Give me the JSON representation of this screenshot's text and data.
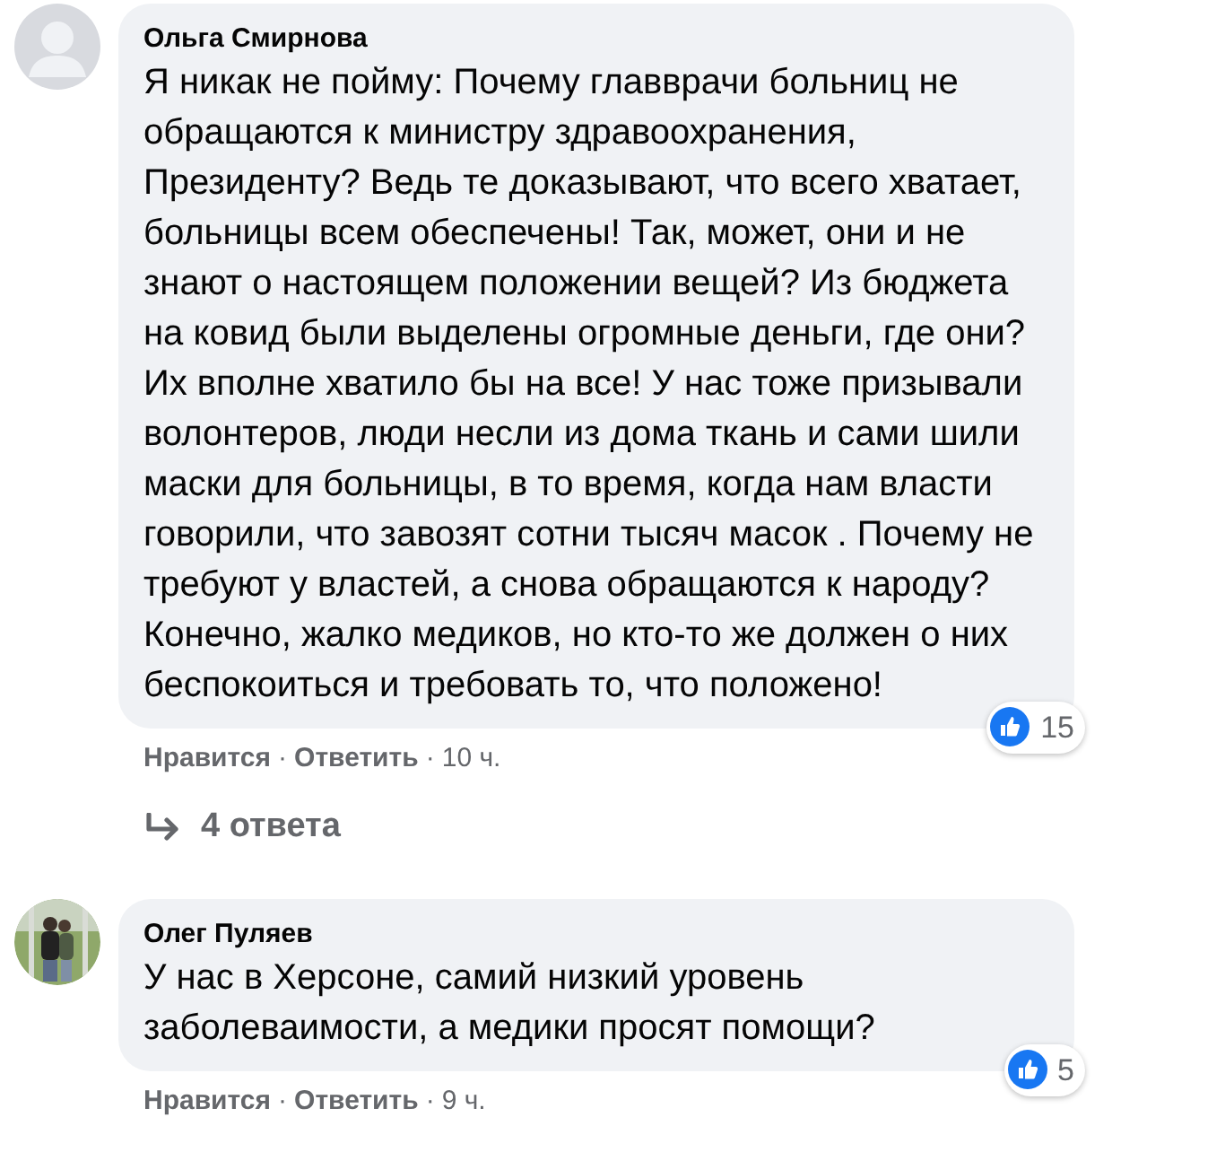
{
  "comments": [
    {
      "author": "Ольга Смирнова",
      "kind": "silhouette",
      "separator": "·",
      "text": "Я никак не пойму: Почему главврачи больниц не обращаются к министру здравоохранения, Президенту? Ведь те доказывают, что всего хватает, больницы всем обеспечены! Так, может, они и не знают о настоящем положении вещей? Из бюджета на ковид были выделены огромные деньги, где они? Их вполне хватило бы на все! У нас тоже призывали волонтеров, люди несли из дома ткань и сами шили маски для больницы, в то время, когда нам власти говорили, что завозят сотни тысяч масок . Почему не требуют у властей, а снова обращаются к народу? Конечно, жалко медиков, но кто-то же должен о них беспокоиться и требовать то, что положено!",
      "likes": "15",
      "like_action": "Нравится",
      "reply_action": "Ответить",
      "time": "10 ч.",
      "replies": "4 ответа"
    },
    {
      "author": "Олег Пуляев",
      "kind": "picture",
      "separator": "·",
      "text": "У нас в Херсоне, самий низкий уровень заболеваимости, а медики просят помощи?",
      "likes": "5",
      "like_action": "Нравится",
      "reply_action": "Ответить",
      "time": "9 ч."
    }
  ]
}
